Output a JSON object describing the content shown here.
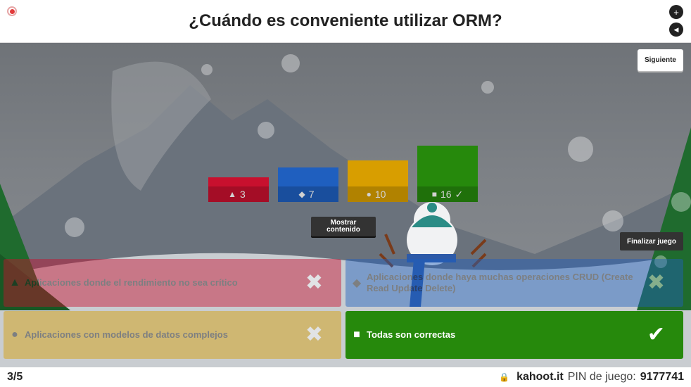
{
  "header": {
    "title": "¿Cuándo es conveniente utilizar ORM?",
    "plus_glyph": "+",
    "sound_glyph": "◀"
  },
  "controls": {
    "next_label": "Siguiente",
    "show_label_line1": "Mostrar",
    "show_label_line2": "contenido",
    "end_label": "Finalizar juego"
  },
  "results": [
    {
      "shape": "triangle-icon",
      "glyph": "▲",
      "count": "3",
      "check": "",
      "color": "#c8102e"
    },
    {
      "shape": "diamond-icon",
      "glyph": "◆",
      "count": "7",
      "check": "",
      "color": "#1f5fbf"
    },
    {
      "shape": "circle-icon",
      "glyph": "●",
      "count": "10",
      "check": "",
      "color": "#d89e00"
    },
    {
      "shape": "square-icon",
      "glyph": "■",
      "count": "16",
      "check": "✓",
      "color": "#26890c"
    }
  ],
  "answers": [
    {
      "shape_glyph": "▲",
      "text": "Aplicaciones donde el rendimiento no sea crítico",
      "mark": "✖",
      "correct": false,
      "color": "#c8102e"
    },
    {
      "shape_glyph": "◆",
      "text": "Aplicaciones donde haya muchas operaciones CRUD (Create Read Update Delete)",
      "mark": "✖",
      "correct": false,
      "color": "#1f5fbf"
    },
    {
      "shape_glyph": "●",
      "text": "Aplicaciones con modelos de datos complejos",
      "mark": "✖",
      "correct": false,
      "color": "#d89e00"
    },
    {
      "shape_glyph": "■",
      "text": "Todas son correctas",
      "mark": "✔",
      "correct": true,
      "color": "#26890c"
    }
  ],
  "footer": {
    "progress": "3/5",
    "lock_glyph": "🔒",
    "brand": "kahoot.it",
    "pin_label": "PIN de juego:",
    "pin": "9177741"
  }
}
